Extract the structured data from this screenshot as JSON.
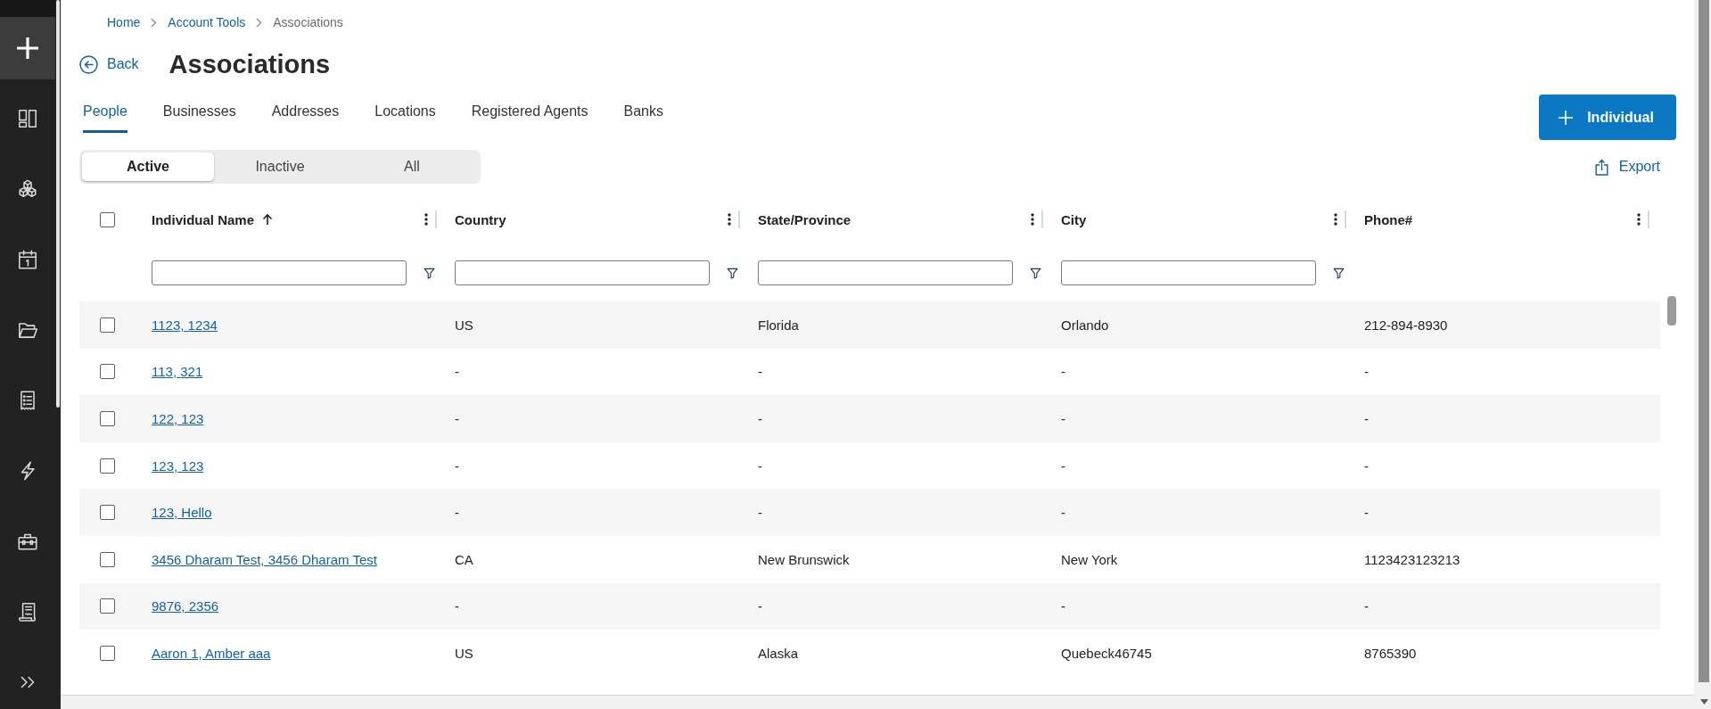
{
  "breadcrumb": [
    {
      "label": "Home",
      "current": false
    },
    {
      "label": "Account Tools",
      "current": false
    },
    {
      "label": "Associations",
      "current": true
    }
  ],
  "back_link": {
    "label": "Back"
  },
  "title": "Associations",
  "tabs": [
    {
      "label": "People",
      "selected": true
    },
    {
      "label": "Businesses",
      "selected": false
    },
    {
      "label": "Addresses",
      "selected": false
    },
    {
      "label": "Locations",
      "selected": false
    },
    {
      "label": "Registered Agents",
      "selected": false
    },
    {
      "label": "Banks",
      "selected": false
    }
  ],
  "add_button": {
    "label": "Individual"
  },
  "status_filter": [
    {
      "label": "Active",
      "selected": true
    },
    {
      "label": "Inactive",
      "selected": false
    },
    {
      "label": "All",
      "selected": false
    }
  ],
  "export_link": {
    "label": "Export"
  },
  "table": {
    "select_all": {
      "checked": false
    },
    "columns": [
      {
        "label": "Individual Name",
        "kind": "link",
        "sorted": true,
        "filter": true
      },
      {
        "label": "Country",
        "kind": "text",
        "sorted": false,
        "filter": true
      },
      {
        "label": "State/Province",
        "kind": "text",
        "sorted": false,
        "filter": true
      },
      {
        "label": "City",
        "kind": "text",
        "sorted": false,
        "filter": true
      },
      {
        "label": "Phone#",
        "kind": "text",
        "sorted": false,
        "filter": false
      }
    ],
    "rows": [
      {
        "checked": false,
        "cells": [
          "1123, 1234",
          "US",
          "Florida",
          "Orlando",
          "212-894-8930"
        ]
      },
      {
        "checked": false,
        "cells": [
          "113, 321",
          "-",
          "-",
          "-",
          "-"
        ]
      },
      {
        "checked": false,
        "cells": [
          "122, 123",
          "-",
          "-",
          "-",
          "-"
        ]
      },
      {
        "checked": false,
        "cells": [
          "123, 123",
          "-",
          "-",
          "-",
          "-"
        ]
      },
      {
        "checked": false,
        "cells": [
          "123, Hello",
          "-",
          "-",
          "-",
          "-"
        ]
      },
      {
        "checked": false,
        "cells": [
          "3456 Dharam Test, 3456 Dharam Test",
          "CA",
          "New Brunswick",
          "New York",
          "1123423123213"
        ]
      },
      {
        "checked": false,
        "cells": [
          "9876, 2356",
          "-",
          "-",
          "-",
          "-"
        ]
      },
      {
        "checked": false,
        "cells": [
          "Aaron 1, Amber aaa",
          "US",
          "Alaska",
          "Quebeck46745",
          "8765390"
        ]
      }
    ]
  }
}
